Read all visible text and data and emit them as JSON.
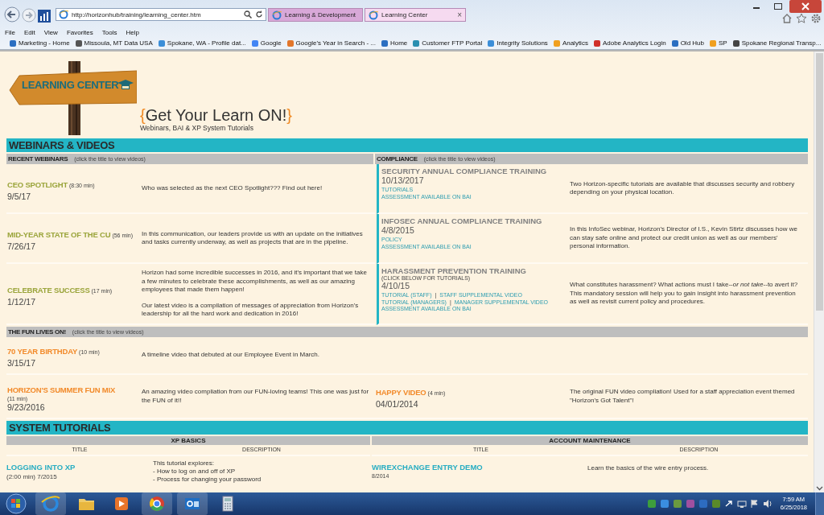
{
  "browser": {
    "url": "http://horizonhub/training/learning_center.htm",
    "tabs": [
      {
        "label": "Learning & Development",
        "selected": false
      },
      {
        "label": "Learning Center",
        "selected": true,
        "close": "×"
      }
    ],
    "menu": [
      "File",
      "Edit",
      "View",
      "Favorites",
      "Tools",
      "Help"
    ],
    "favorites": [
      "Marketing - Home",
      "Missoula, MT  Data USA",
      "Spokane, WA - Profile dat...",
      "Google",
      "Google's Year in Search - ...",
      "Home",
      "Customer FTP Portal",
      "Integrity Solutions",
      "Analytics",
      "Adobe Analytics Login",
      "Old Hub",
      "SP",
      "Spokane Regional Transp..."
    ]
  },
  "header": {
    "logo_text": "LEARNING CENTER",
    "brace_open": "{",
    "title": "Get Your Learn ON!",
    "brace_close": "}",
    "subtitle": "Webinars, BAI & XP System Tutorials"
  },
  "webinars": {
    "heading": "WEBINARS & VIDEOS",
    "recent": {
      "heading": "RECENT WEBINARS",
      "hint": "(click the title to view videos)",
      "items": [
        {
          "title": "CEO SPOTLIGHT",
          "duration": "(8:30 min)",
          "date": "9/5/17",
          "description": [
            "Who was selected as the next CEO Spotlight??? Find out here!"
          ]
        },
        {
          "title": "MID-YEAR STATE OF THE CU",
          "duration": "(56 min)",
          "date": "7/26/17",
          "description": [
            "In this communication, our leaders provide us with an update on the initiatives and tasks currently underway, as well as projects that are in the pipeline."
          ]
        },
        {
          "title": "CELEBRATE SUCCESS",
          "duration": "(17 min)",
          "date": "1/12/17",
          "description": [
            "Horizon had some incredible successes in 2016, and it's important that we take a few minutes to celebrate these accomplishments, as well as our amazing employees that made them happen!",
            "Our latest video is a compilation of messages of appreciation from Horizon's leadership for all the hard work and dedication in 2016!"
          ]
        }
      ]
    },
    "compliance": {
      "heading": "COMPLIANCE",
      "hint": "(click the title to view videos)",
      "separator": "|",
      "items": [
        {
          "title": "SECURITY ANNUAL COMPLIANCE TRAINING",
          "date": "10/13/2017",
          "links": [
            [
              "TUTORIALS"
            ],
            [
              "ASSESSMENT AVAILABLE ON BAI"
            ]
          ],
          "description": "Two Horizon-specific tutorials are available that discusses security and robbery depending on your physical location."
        },
        {
          "title": "INFOSEC ANNUAL COMPLIANCE TRAINING",
          "date": "4/8/2015",
          "links": [
            [
              "POLICY"
            ],
            [
              "ASSESSMENT AVAILABLE ON BAI"
            ]
          ],
          "description": "In this InfoSec webinar, Horizon's Director of I.S., Kevin Stirtz discusses how we can stay safe online and protect our credit union as well as our members' personal information."
        },
        {
          "title": "HARASSMENT PREVENTION TRAINING",
          "note": "(CLICK BELOW FOR TUTORIALS)",
          "date": "4/10/15",
          "links": [
            [
              "TUTORIAL (STAFF)",
              "STAFF SUPPLEMENTAL VIDEO"
            ],
            [
              "TUTORIAL (MANAGERS)",
              "MANAGER SUPPLEMENTAL VIDEO"
            ],
            [
              "ASSESSMENT AVAILABLE ON BAI"
            ]
          ],
          "description": "What constitutes harassment?  What actions must I take--*or not take*--to avert it?  This mandatory session will help you to gain insight into harassment prevention as well as revisit current policy and procedures."
        }
      ]
    }
  },
  "fun": {
    "heading": "THE FUN LIVES ON!",
    "hint": "(click the title to view videos)",
    "rows": [
      [
        {
          "title": "70 YEAR BIRTHDAY",
          "duration": "(10 min)",
          "duration_below": false,
          "date": "3/15/17",
          "description": "A timeline video that debuted at our Employee Event in March."
        }
      ],
      [
        {
          "title": "HORIZON'S SUMMER FUN MIX",
          "duration": "(11 min)",
          "duration_below": true,
          "date": "9/23/2016",
          "description": "An amazing video compliation from our FUN-loving teams!  This one was just for the FUN of it!!"
        },
        {
          "title": "HAPPY VIDEO",
          "duration": "(4 min)",
          "duration_below": false,
          "date": "04/01/2014",
          "description": "The original FUN video compliation!  Used for a staff appreciation event themed \"Horizon's Got Talent\"!"
        }
      ]
    ]
  },
  "tutorials": {
    "heading": "SYSTEM TUTORIALS",
    "groups": [
      {
        "heading": "XP BASICS",
        "columns": [
          "TITLE",
          "DESCRIPTION"
        ],
        "rows": [
          {
            "title": "LOGGING INTO XP",
            "meta": "(2:00 min)  7/2015",
            "description": [
              "This tutorial explores:",
              "- How to log on and off of XP",
              "- Process for changing your password"
            ]
          }
        ]
      },
      {
        "heading": "ACCOUNT MAINTENANCE",
        "columns": [
          "TITLE",
          "DESCRIPTION"
        ],
        "rows": [
          {
            "title": "WIREXCHANGE ENTRY DEMO",
            "meta": "8/2014",
            "description": [
              "Learn the basics of the wire entry process."
            ]
          }
        ]
      }
    ]
  },
  "taskbar": {
    "time": "7:59 AM",
    "date": "6/25/2018"
  }
}
